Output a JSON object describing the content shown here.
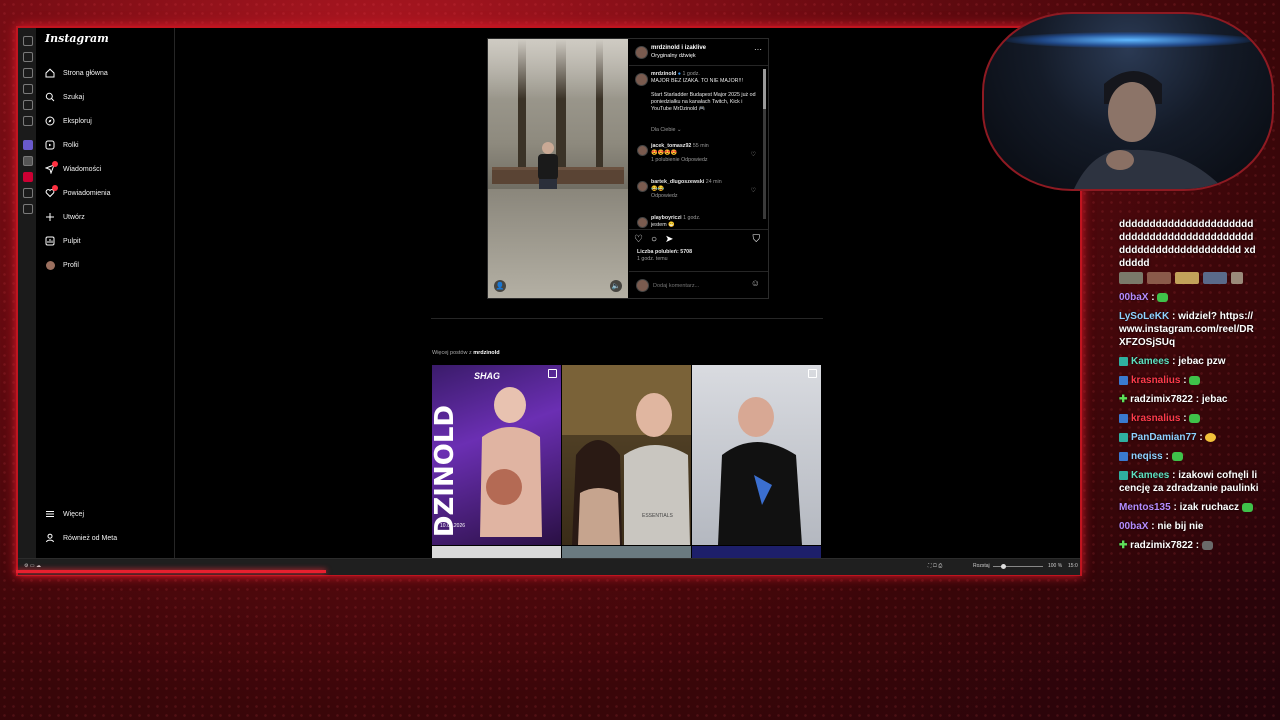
{
  "instagram": {
    "logo": "Instagram",
    "nav": [
      {
        "label": "Strona główna",
        "icon": "home-icon"
      },
      {
        "label": "Szukaj",
        "icon": "search-icon"
      },
      {
        "label": "Eksploruj",
        "icon": "compass-icon"
      },
      {
        "label": "Rolki",
        "icon": "reels-icon"
      },
      {
        "label": "Wiadomości",
        "icon": "messenger-icon"
      },
      {
        "label": "Powiadomienia",
        "icon": "heart-icon"
      },
      {
        "label": "Utwórz",
        "icon": "plus-icon"
      },
      {
        "label": "Pulpit",
        "icon": "dashboard-icon"
      },
      {
        "label": "Profil",
        "icon": "profile-avatar"
      }
    ],
    "more": "Więcej",
    "also_from_meta": "Również od Meta"
  },
  "post": {
    "author_header": "mrdzinold i izaklive",
    "audio": "Oryginalny dźwięk",
    "caption_user": "mrdzinold",
    "caption_time": "1 godz.",
    "caption_line1": "MAJOR BEZ IZAKA. TO NIE MAJOR!!!",
    "caption_line2": "Start Starladder Budapest Major 2025 już od poniedziałku na kanałach Twitch, Kick i YouTube MrDzinold 🎮",
    "for_you": "Dla Ciebie",
    "comments": [
      {
        "user": "jacek_tomasz92",
        "time": "55 min",
        "text": "😍😍😍😍",
        "meta1": "1 polubienie",
        "meta2": "Odpowiedz"
      },
      {
        "user": "bartek_dlugoszewski",
        "time": "24 min",
        "text": "😂😂",
        "meta1": "Odpowiedz",
        "meta2": ""
      },
      {
        "user": "playboyriczi",
        "time": "1 godz.",
        "text": "jestem 😁",
        "meta1": "",
        "meta2": ""
      }
    ],
    "likes": "Liczba polubień: 5708",
    "time_ago": "1 godz. temu",
    "add_comment_placeholder": "Dodaj komentarz..."
  },
  "more_posts": {
    "prefix": "Więcej postów z",
    "user": "mrdzinold"
  },
  "tiles": [
    {
      "title": "DZINOLD",
      "top": "SHAG",
      "date": "10.01.2026"
    },
    {
      "title": "",
      "hoodie": "ESSENTIALS"
    },
    {
      "title": ""
    }
  ],
  "statusbar": {
    "mode": "Rozstaj",
    "zoom": "100 %",
    "time": "15:0"
  },
  "chat": [
    {
      "user": "",
      "text": "dddddddddddddddddddddddddddddddddddddddddddddddddddddddddddddddd xdddddd",
      "color": "#ffffff"
    },
    {
      "user": "00baX",
      "text": "",
      "color": "#b58cff"
    },
    {
      "user": "LySoLeKK",
      "text": "widziel? https://www.instagram.com/reel/DRXFZOSjSUq",
      "color": "#8fd1ff"
    },
    {
      "user": "Kamees",
      "text": "jebac pzw",
      "color": "#5fe0c0"
    },
    {
      "user": "krasnalius",
      "text": "",
      "color": "#ff3b4b"
    },
    {
      "user": "radzimix7822",
      "text": "jebac",
      "color": "#ffffff"
    },
    {
      "user": "krasnalius",
      "text": "",
      "color": "#ff3b4b"
    },
    {
      "user": "PanDamian77",
      "text": "",
      "color": "#8fd1ff"
    },
    {
      "user": "neqiss",
      "text": "",
      "color": "#8fd1ff"
    },
    {
      "user": "Kamees",
      "text": "izakowi cofnęli licencję za zdradzanie paulinki",
      "color": "#5fe0c0"
    },
    {
      "user": "Mentos135",
      "text": "izak ruchacz",
      "color": "#b58cff"
    },
    {
      "user": "00baX",
      "text": "nie bij nie",
      "color": "#b58cff"
    },
    {
      "user": "radzimix7822",
      "text": "",
      "color": "#ffffff"
    }
  ]
}
